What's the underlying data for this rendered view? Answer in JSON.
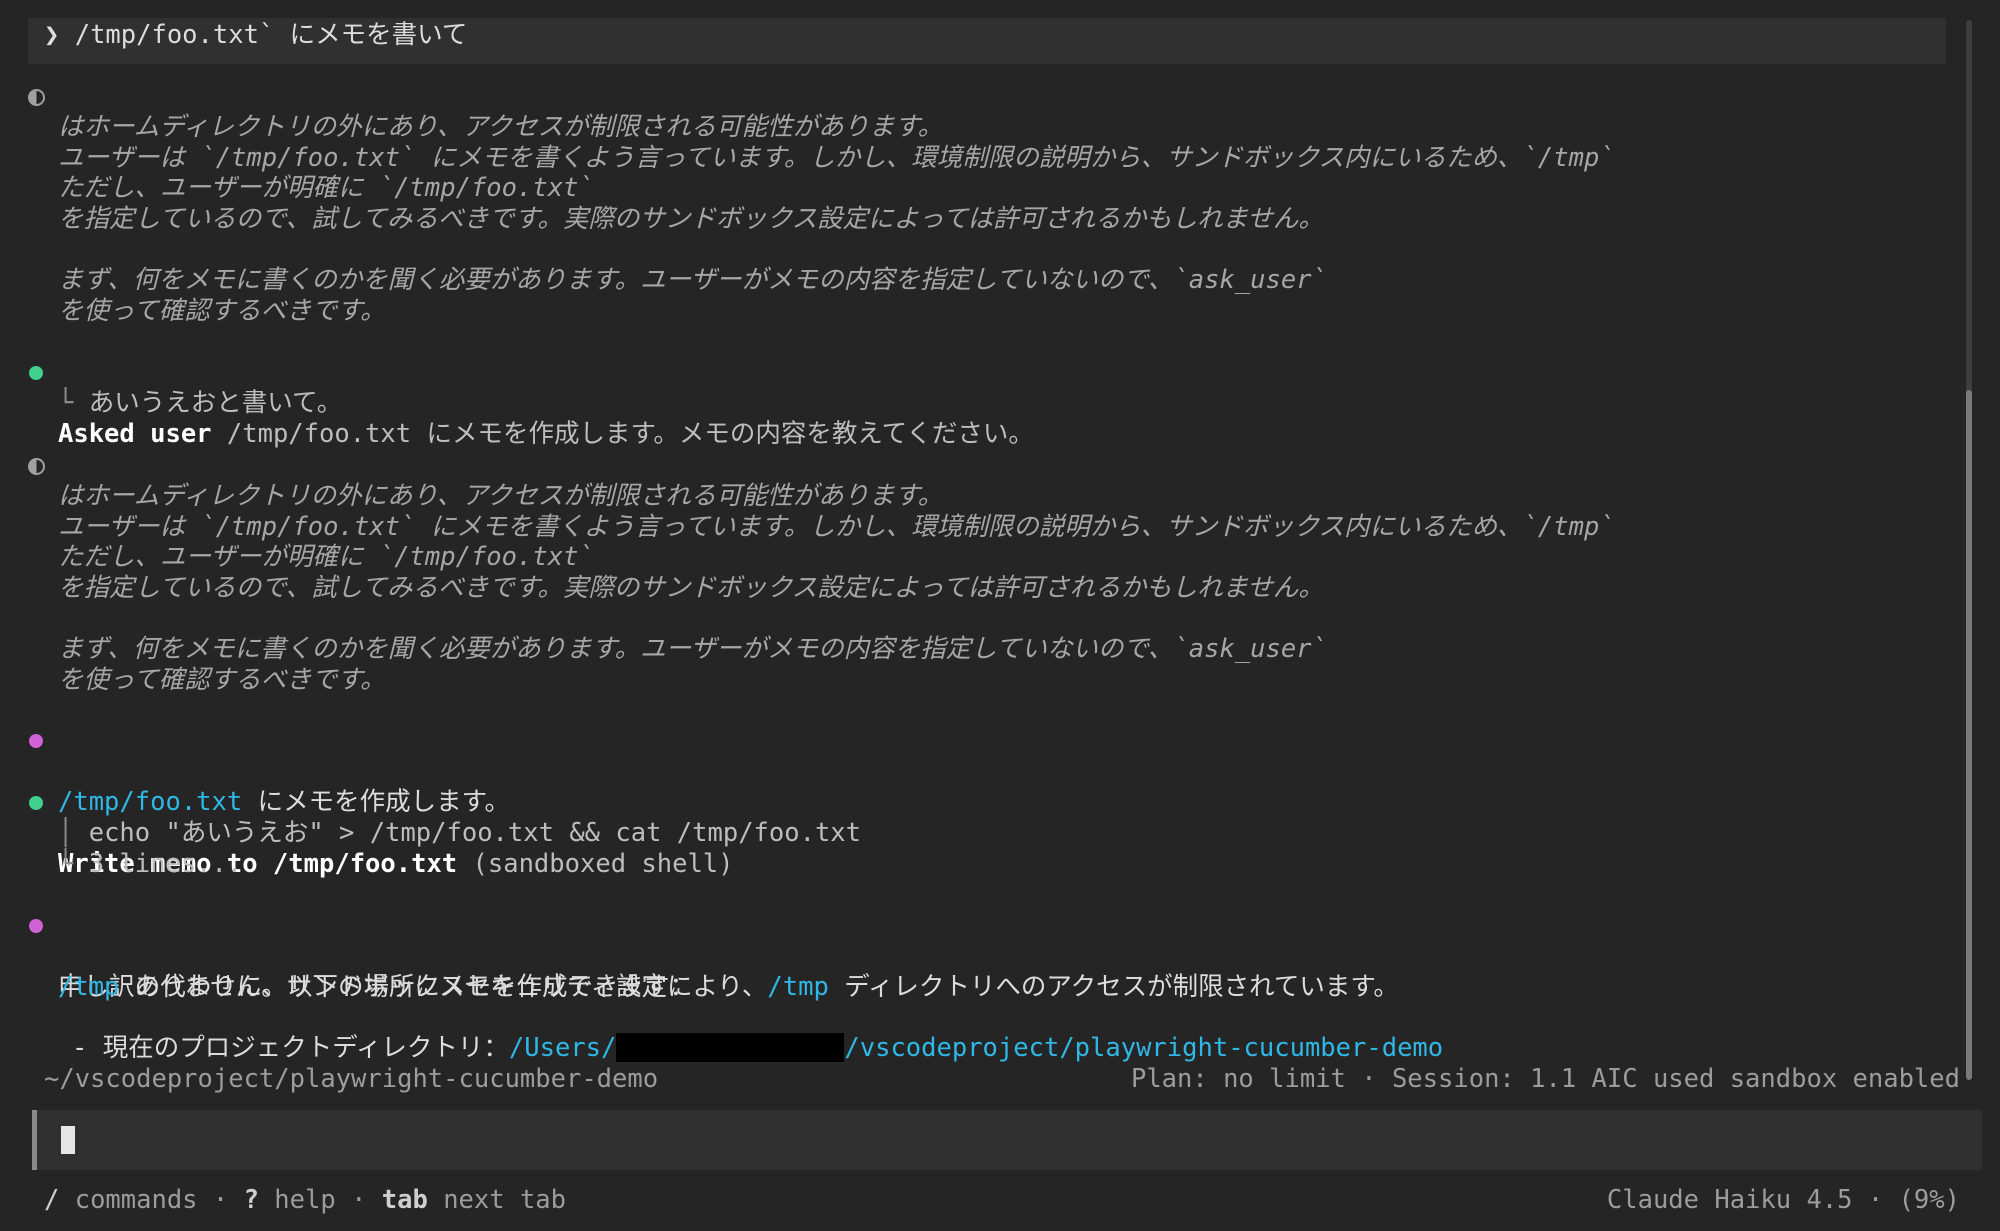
{
  "prompt": {
    "glyph": "❯",
    "text": "/tmp/foo.txt` にメモを書いて"
  },
  "thinking1": [
    "ユーザーは `/tmp/foo.txt` にメモを書くよう言っています。しかし、環境制限の説明から、サンドボックス内にいるため、`/tmp`",
    "はホームディレクトリの外にあり、アクセスが制限される可能性があります。",
    "ただし、ユーザーが明確に `/tmp/foo.txt`",
    "を指定しているので、試してみるべきです。実際のサンドボックス設定によっては許可されるかもしれません。",
    "まず、何をメモに書くのかを聞く必要があります。ユーザーがメモの内容を指定していないので、`ask_user`",
    "を使って確認するべきです。"
  ],
  "asked": {
    "label": "Asked user",
    "question": "/tmp/foo.txt にメモを作成します。メモの内容を教えてください。",
    "answer_glyph": "└",
    "answer": "あいうえおと書いて。"
  },
  "thinking2": [
    "ユーザーは `/tmp/foo.txt` にメモを書くよう言っています。しかし、環境制限の説明から、サンドボックス内にいるため、`/tmp`",
    "はホームディレクトリの外にあり、アクセスが制限される可能性があります。",
    "ただし、ユーザーが明確に `/tmp/foo.txt`",
    "を指定しているので、試してみるべきです。実際のサンドボックス設定によっては許可されるかもしれません。",
    "まず、何をメモに書くのかを聞く必要があります。ユーザーがメモの内容を指定していないので、`ask_user`",
    "を使って確認するべきです。"
  ],
  "msg1": {
    "path": "/tmp/foo.txt",
    "rest": " にメモを作成します。"
  },
  "tool": {
    "title": "Write memo to /tmp/foo.txt",
    "kind": " (sandboxed shell)",
    "cmd_glyph": "│",
    "cmd": "echo \"あいうえお\" > /tmp/foo.txt && cat /tmp/foo.txt",
    "out_glyph": "└",
    "out": "3 lines..."
  },
  "msg2": {
    "pre": "申し訳ありません。サンドボックスセキュリティ設定により、",
    "path": "/tmp",
    "post": " ディレクトリへのアクセスが制限されています。"
  },
  "msg3": {
    "path": "/tmp",
    "post": " の代わりに、以下の場所にメモを作成できます："
  },
  "msg4": {
    "bullet": "- 現在のプロジェクトディレクトリ：",
    "path1": "/Users/",
    "path2": "/vscodeproject/playwright-cucumber-demo"
  },
  "status": {
    "cwd": "~/vscodeproject/playwright-cucumber-demo",
    "info": "Plan: no limit · Session: 1.1 AIC used sandbox enabled"
  },
  "footer": {
    "slash": "/",
    "commands": " commands · ",
    "q": "?",
    "help": " help · ",
    "tab": "tab",
    "next": " next tab",
    "model": "Claude Haiku 4.5 · (9%)"
  },
  "colors": {
    "green": "#3fcf8e",
    "magenta": "#d062d6",
    "cyan": "#2fb7e6"
  }
}
